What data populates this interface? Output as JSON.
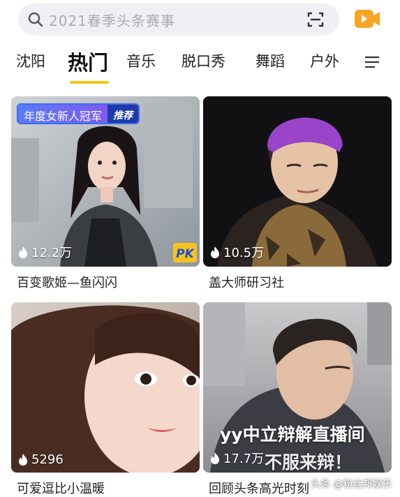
{
  "search": {
    "placeholder": "2021春季头条赛事"
  },
  "tabs": [
    {
      "label": "沈阳"
    },
    {
      "label": "热门"
    },
    {
      "label": "音乐"
    },
    {
      "label": "脱口秀"
    },
    {
      "label": "舞蹈"
    },
    {
      "label": "户外"
    }
  ],
  "active_tab": "热门",
  "colors": {
    "accent": "#f5c518",
    "video_button": "#f5a623",
    "badge": "#3b6cf0"
  },
  "icons": [
    "search-icon",
    "scan-icon",
    "video-camera-icon",
    "menu-icon",
    "fire-icon",
    "pk-icon"
  ],
  "cards": [
    {
      "title": "百变歌姬—鱼闪闪",
      "views": "12.2万",
      "badge_text": "年度女新人冠军",
      "badge_tag": "推荐",
      "pk_label": "PK"
    },
    {
      "title": "盖大师研习社",
      "views": "10.5万"
    },
    {
      "title": "可爱逗比小温暖",
      "views": "5296"
    },
    {
      "title": "回顾头条高光时刻",
      "views": "17.7万",
      "overlay_line1": "yy中立辩解直播间",
      "overlay_line2": "不服来辩！"
    }
  ],
  "watermark": "头条 @粉丝邦娱乐"
}
